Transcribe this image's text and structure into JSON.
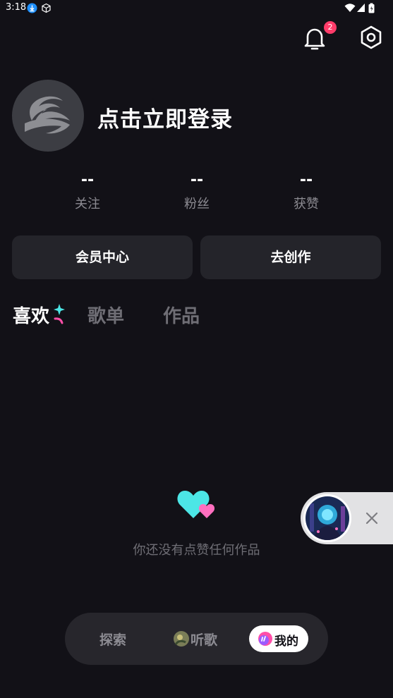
{
  "status_bar": {
    "time": "3:18"
  },
  "header": {
    "notification_count": "2"
  },
  "profile": {
    "login_label": "点击立即登录"
  },
  "stats": [
    {
      "value": "--",
      "label": "关注"
    },
    {
      "value": "--",
      "label": "粉丝"
    },
    {
      "value": "--",
      "label": "获赞"
    }
  ],
  "actions": {
    "vip_label": "会员中心",
    "create_label": "去创作"
  },
  "tabs": [
    {
      "label": "喜欢",
      "active": true
    },
    {
      "label": "歌单",
      "active": false
    },
    {
      "label": "作品",
      "active": false
    }
  ],
  "empty_state": {
    "message": "你还没有点赞任何作品"
  },
  "bottom_nav": [
    {
      "label": "探索",
      "active": false
    },
    {
      "label": "听歌",
      "active": false
    },
    {
      "label": "我的",
      "active": true
    }
  ],
  "colors": {
    "background": "#121117",
    "card": "#24242a",
    "accent_cyan": "#4ce6e6",
    "accent_pink": "#ff4fa8",
    "badge": "#ff3c6a"
  }
}
